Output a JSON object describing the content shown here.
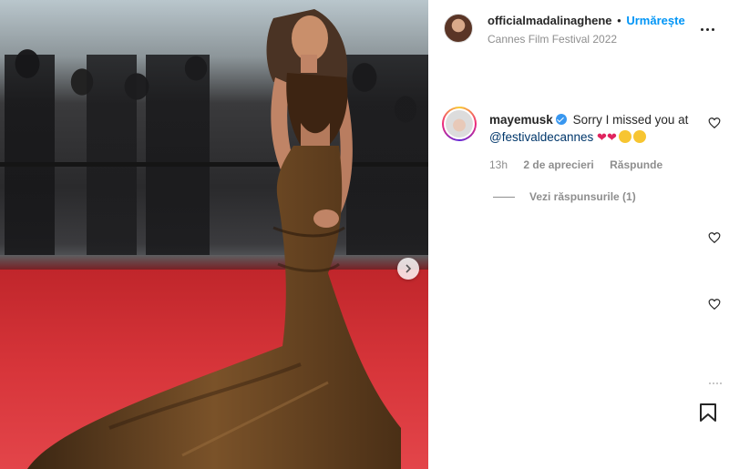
{
  "post": {
    "author": "officialmadalinaghene",
    "separator": "•",
    "follow_label": "Urmărește",
    "location": "Cannes Film Festival 2022",
    "more_options_icon": "more-horizontal-icon"
  },
  "comment": {
    "username": "mayemusk",
    "verified": true,
    "text_before": "Sorry I missed you at",
    "mention": "@festivaldecannes",
    "emojis": [
      "❤",
      "❤"
    ],
    "time": "13h",
    "likes": "2 de aprecieri",
    "reply_label": "Răspunde",
    "view_replies": "Vezi răspunsurile (1)"
  },
  "icons": {
    "carousel_next": "chevron-right-icon",
    "like": "heart-icon",
    "save": "bookmark-icon"
  },
  "colors": {
    "accent": "#0095f6",
    "verified": "#3897f0",
    "text": "#262626",
    "muted": "#8e8e8e"
  }
}
